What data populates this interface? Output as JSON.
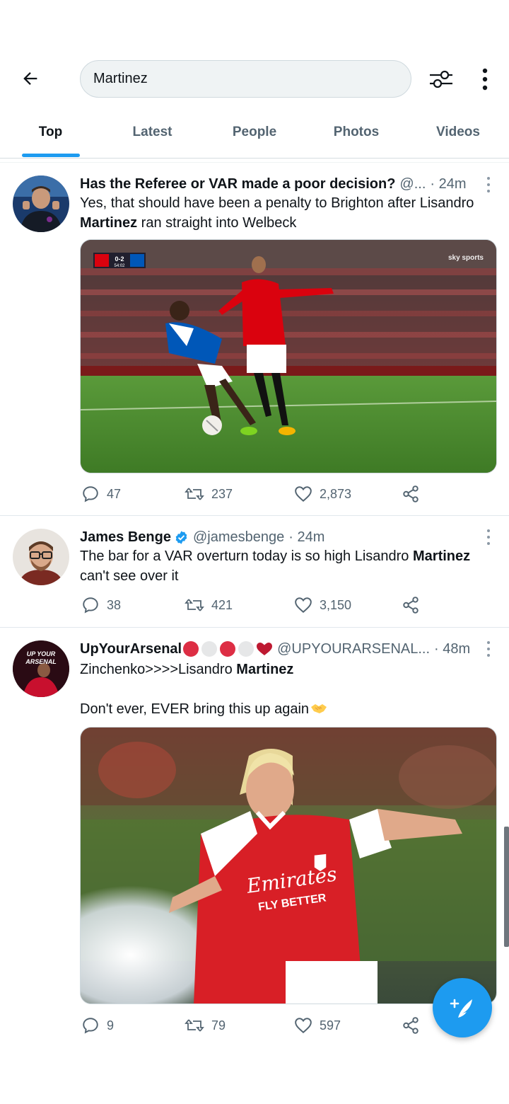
{
  "search": {
    "query": "Martinez"
  },
  "tabs": [
    {
      "label": "Top",
      "active": true
    },
    {
      "label": "Latest",
      "active": false
    },
    {
      "label": "People",
      "active": false
    },
    {
      "label": "Photos",
      "active": false
    },
    {
      "label": "Videos",
      "active": false
    }
  ],
  "tweets": [
    {
      "name": "Has the Referee or VAR made a poor decision?",
      "handle": "@...",
      "time": "· 24m",
      "text_before": "Yes, that should have been a penalty to Brighton after Lisandro ",
      "text_bold": "Martinez",
      "text_after": " ran straight into Welbeck",
      "media": {
        "scoreboard": "0-2",
        "clock": "54:02",
        "broadcaster": "sky sports"
      },
      "replies": "47",
      "retweets": "237",
      "likes": "2,873"
    },
    {
      "name": "James Benge",
      "handle": "@jamesbenge",
      "time": "· 24m",
      "verified": true,
      "text_before": "The bar for a VAR overturn today is so high Lisandro ",
      "text_bold": "Martinez",
      "text_after": " can't see over it",
      "replies": "38",
      "retweets": "421",
      "likes": "3,150"
    },
    {
      "name": "UpYourArsenal",
      "handle": "@UPYOURARSENAL...",
      "time": "· 48m",
      "avatar_text": "UP YOUR ARSENAL",
      "text_line1_before": "Zinchenko>>>>Lisandro ",
      "text_line1_bold": "Martinez",
      "text_line2": "Don't ever, EVER bring this up again",
      "media": {
        "sponsor_line1": "Emirates",
        "sponsor_line2": "FLY BETTER"
      },
      "replies": "9",
      "retweets": "79",
      "likes": "597"
    }
  ],
  "colors": {
    "accent": "#1d9bf0",
    "text_primary": "#0f1419",
    "text_secondary": "#536471",
    "arsenal_red": "#d81f26",
    "united_red": "#da020e",
    "brighton_blue": "#0057b8"
  },
  "icons": [
    "back-arrow-icon",
    "filter-icon",
    "more-vertical-icon",
    "reply-icon",
    "retweet-icon",
    "like-icon",
    "share-icon",
    "compose-icon",
    "verified-badge-icon"
  ]
}
